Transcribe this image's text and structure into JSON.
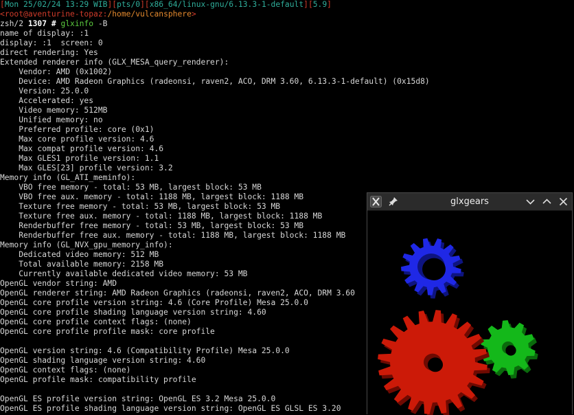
{
  "terminal": {
    "prompt_status": {
      "open1": "[",
      "datetime": "Mon 25/02/24 13:29 WIB",
      "close1": "][",
      "tty": "pts/0",
      "close2": "][",
      "arch": "x86_64/linux-gnu/6.13.3-1-default",
      "close3": "][",
      "load": "5.9",
      "close4": "]"
    },
    "prompt_user": {
      "lt": "<",
      "userhost": "root@aventurine-topaz",
      "colon": ":",
      "path": "/home/vulcansphere",
      "gt": ">"
    },
    "prompt_cmd": {
      "shell": "zsh/2 ",
      "histnum": "1307",
      "hash": " # ",
      "command": "glxinfo",
      "args": " -B"
    },
    "output_lines": [
      "name of display: :1",
      "display: :1  screen: 0",
      "direct rendering: Yes",
      "Extended renderer info (GLX_MESA_query_renderer):",
      "    Vendor: AMD (0x1002)",
      "    Device: AMD Radeon Graphics (radeonsi, raven2, ACO, DRM 3.60, 6.13.3-1-default) (0x15d8)",
      "    Version: 25.0.0",
      "    Accelerated: yes",
      "    Video memory: 512MB",
      "    Unified memory: no",
      "    Preferred profile: core (0x1)",
      "    Max core profile version: 4.6",
      "    Max compat profile version: 4.6",
      "    Max GLES1 profile version: 1.1",
      "    Max GLES[23] profile version: 3.2",
      "Memory info (GL_ATI_meminfo):",
      "    VBO free memory - total: 53 MB, largest block: 53 MB",
      "    VBO free aux. memory - total: 1188 MB, largest block: 1188 MB",
      "    Texture free memory - total: 53 MB, largest block: 53 MB",
      "    Texture free aux. memory - total: 1188 MB, largest block: 1188 MB",
      "    Renderbuffer free memory - total: 53 MB, largest block: 53 MB",
      "    Renderbuffer free aux. memory - total: 1188 MB, largest block: 1188 MB",
      "Memory info (GL_NVX_gpu_memory_info):",
      "    Dedicated video memory: 512 MB",
      "    Total available memory: 2158 MB",
      "    Currently available dedicated video memory: 53 MB",
      "OpenGL vendor string: AMD",
      "OpenGL renderer string: AMD Radeon Graphics (radeonsi, raven2, ACO, DRM 3.60",
      "OpenGL core profile version string: 4.6 (Core Profile) Mesa 25.0.0",
      "OpenGL core profile shading language version string: 4.60",
      "OpenGL core profile context flags: (none)",
      "OpenGL core profile profile mask: core profile",
      "",
      "OpenGL version string: 4.6 (Compatibility Profile) Mesa 25.0.0",
      "OpenGL shading language version string: 4.60",
      "OpenGL context flags: (none)",
      "OpenGL profile mask: compatibility profile",
      "",
      "OpenGL ES profile version string: OpenGL ES 3.2 Mesa 25.0.0",
      "OpenGL ES profile shading language version string: OpenGL ES GLSL ES 3.20"
    ]
  },
  "glxgears_window": {
    "title": "glxgears",
    "icons": {
      "app": "x-window-icon",
      "pin": "pin-icon",
      "minimize": "chevron-down-icon",
      "maximize": "chevron-up-icon",
      "close": "close-icon"
    },
    "gear_colors": {
      "red": "#cc1a08",
      "green": "#14b81a",
      "blue": "#1f28e6"
    }
  },
  "colors": {
    "bracket": "#d23c2b",
    "teal": "#2fae9b",
    "orange": "#e58a2e",
    "command_green": "#5ccc3f"
  }
}
